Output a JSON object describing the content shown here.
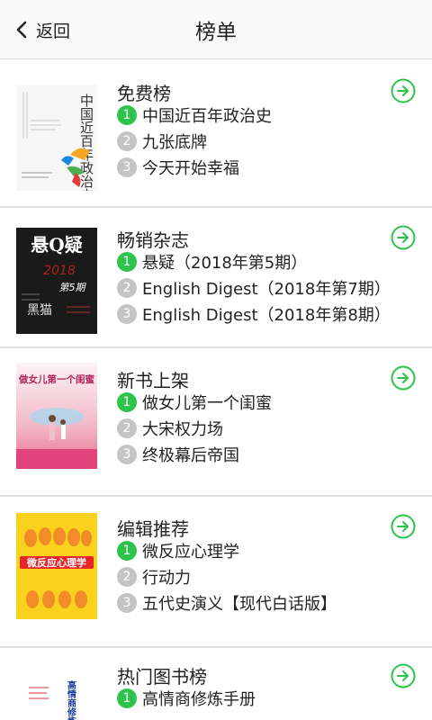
{
  "header": {
    "back_label": "返回",
    "title": "榜单"
  },
  "colors": {
    "accent": "#2ec34a",
    "rank_inactive": "#c4c4c4"
  },
  "sections": [
    {
      "name": "免费榜",
      "cover": {
        "text": "中国近百年政治史"
      },
      "items": [
        {
          "rank": "1",
          "title": "中国近百年政治史"
        },
        {
          "rank": "2",
          "title": "九张底牌"
        },
        {
          "rank": "3",
          "title": "今天开始幸福"
        }
      ]
    },
    {
      "name": "畅销杂志",
      "cover": {
        "title": "悬Q疑",
        "year": "2018",
        "issue": "第5期",
        "side": "黑猫"
      },
      "items": [
        {
          "rank": "1",
          "title": "悬疑（2018年第5期）"
        },
        {
          "rank": "2",
          "title": "English Digest（2018年第7期）"
        },
        {
          "rank": "3",
          "title": "English Digest（2018年第8期）"
        }
      ]
    },
    {
      "name": "新书上架",
      "cover": {
        "title": "做女儿第一个闺蜜"
      },
      "items": [
        {
          "rank": "1",
          "title": "做女儿第一个闺蜜"
        },
        {
          "rank": "2",
          "title": "大宋权力场"
        },
        {
          "rank": "3",
          "title": "终极幕后帝国"
        }
      ]
    },
    {
      "name": "编辑推荐",
      "cover": {
        "title": "微反应心理学"
      },
      "items": [
        {
          "rank": "1",
          "title": "微反应心理学"
        },
        {
          "rank": "2",
          "title": "行动力"
        },
        {
          "rank": "3",
          "title": "五代史演义【现代白话版】"
        }
      ]
    },
    {
      "name": "热门图书榜",
      "cover": {
        "title": "高情商修炼手"
      },
      "items": [
        {
          "rank": "1",
          "title": "高情商修炼手册"
        }
      ]
    }
  ]
}
